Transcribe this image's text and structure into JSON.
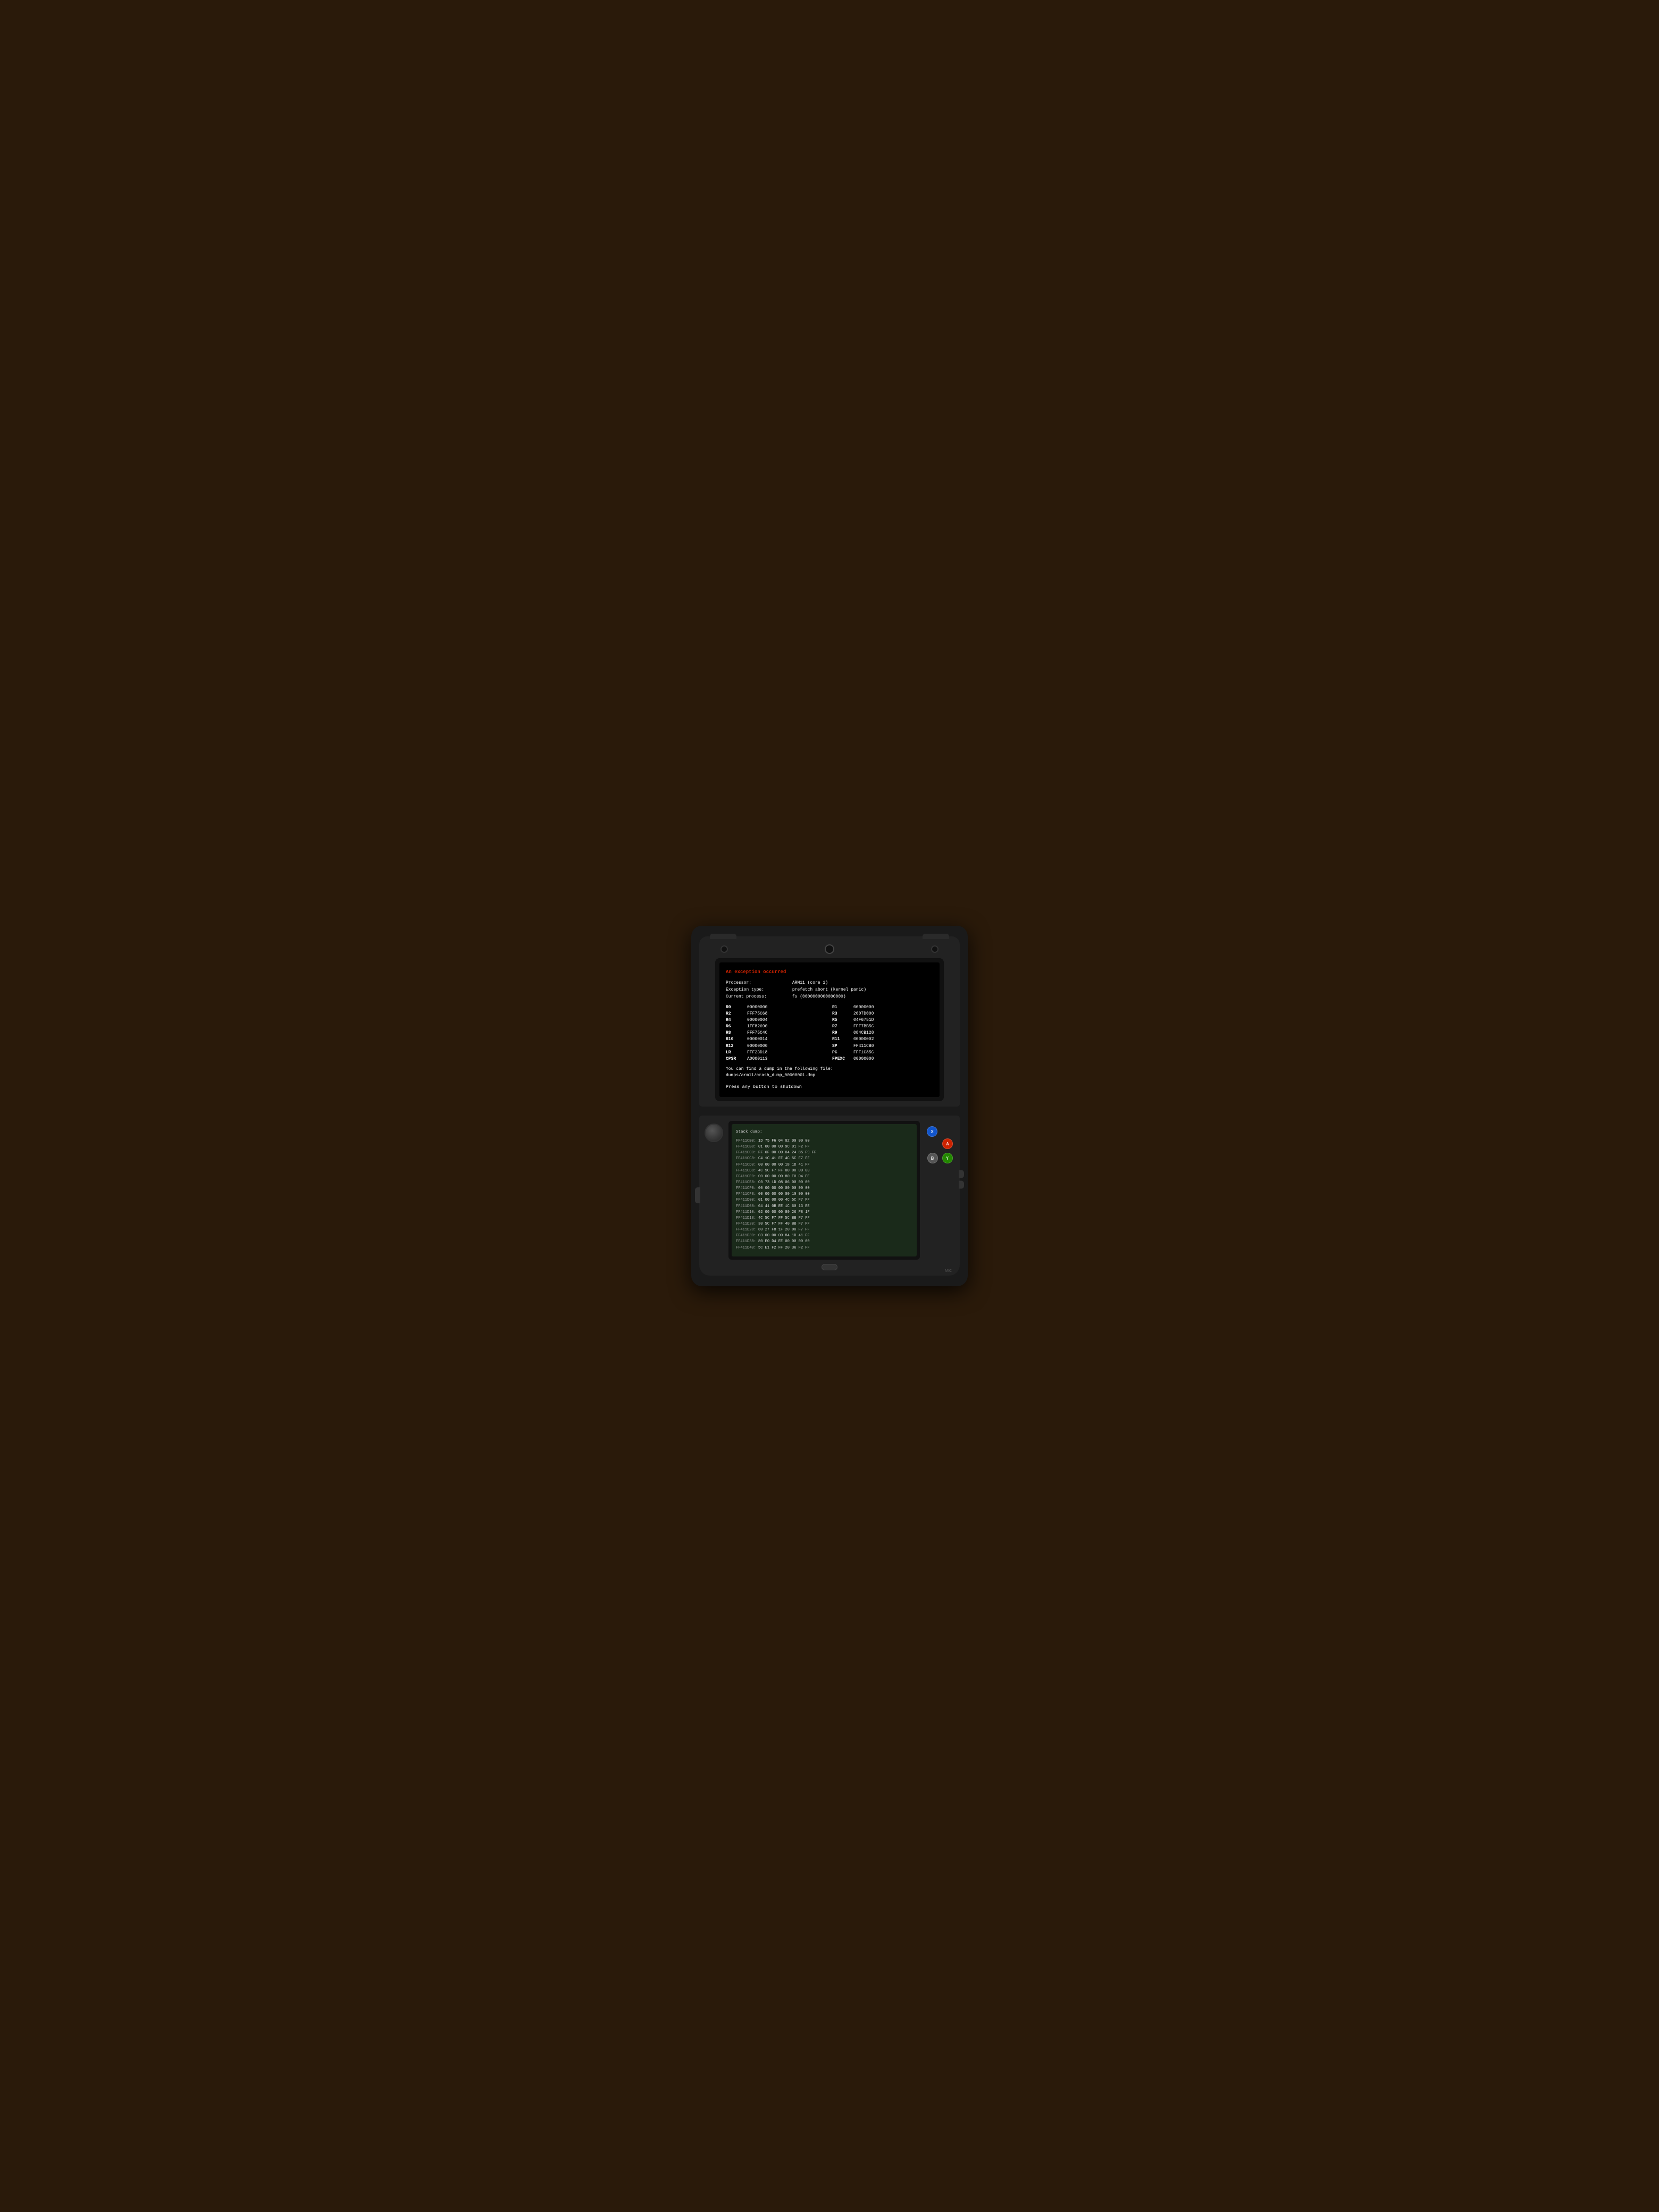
{
  "device": {
    "type": "Nintendo 3DS",
    "color": "black"
  },
  "top_screen": {
    "error_title": "An exception occurred",
    "processor_label": "Processor:",
    "processor_value": "ARM11 (core 1)",
    "exception_label": "Exception type:",
    "exception_value": "prefetch abort (kernel panic)",
    "process_label": "Current process:",
    "process_value": "fs (0000000000000000)",
    "registers": [
      {
        "name": "R0",
        "value": "00000000",
        "r_name": "R1",
        "r_value": "00000000"
      },
      {
        "name": "R2",
        "value": "FFF75C68",
        "r_name": "R3",
        "r_value": "2007D000"
      },
      {
        "name": "R4",
        "value": "00000004",
        "r_name": "R5",
        "r_value": "04F6751D"
      },
      {
        "name": "R6",
        "value": "1FF82690",
        "r_name": "R7",
        "r_value": "FFF7BB5C"
      },
      {
        "name": "R8",
        "value": "FFF75C4C",
        "r_name": "R9",
        "r_value": "084CB128"
      },
      {
        "name": "R10",
        "value": "00000014",
        "r_name": "R11",
        "r_value": "00000002"
      },
      {
        "name": "R12",
        "value": "00000000",
        "r_name": "SP",
        "r_value": "FF411CB0"
      },
      {
        "name": "LR",
        "value": "FFF23D18",
        "r_name": "PC",
        "r_value": "FFF1C85C"
      },
      {
        "name": "CPSR",
        "value": "A0000113",
        "r_name": "FPEXC",
        "r_value": "00000000"
      }
    ],
    "dump_message": "You can find a dump in the following file:",
    "dump_path": "dumps/arm11/crash_dump_00000001.dmp",
    "press_message": "Press any button to shutdown"
  },
  "bottom_screen": {
    "title": "Stack dump:",
    "rows": [
      {
        "addr": "FF411CB0:",
        "data": "1D 75 F6 04  02 00 00 00"
      },
      {
        "addr": "FF411CB8:",
        "data": "01 00 00 00  9C 01 F2 FF"
      },
      {
        "addr": "FF411CC0:",
        "data": "FF 6F 00 00  04 24 85 F9 FF"
      },
      {
        "addr": "FF411CC8:",
        "data": "C4 1C 41 FF  4C 5C F7 FF"
      },
      {
        "addr": "FF411CD0:",
        "data": "00 00 00 00  18 1D 41 FF"
      },
      {
        "addr": "FF411CD8:",
        "data": "4C 5C F7 FF  00 00 00 00"
      },
      {
        "addr": "FF411CE0:",
        "data": "00 00 00 00  80 E0 D4 EE"
      },
      {
        "addr": "FF411CE8:",
        "data": "C0 73 1D 08  06 00 00 00"
      },
      {
        "addr": "FF411CF0:",
        "data": "00 00 00 00  00 00 00 00"
      },
      {
        "addr": "FF411CF8:",
        "data": "00 00 00 00  00 10 00 00"
      },
      {
        "addr": "FF411D00:",
        "data": "01 00 00 00  4C 5C F7 FF"
      },
      {
        "addr": "FF411D08:",
        "data": "04 41 0B EE  1C 60 13 EE"
      },
      {
        "addr": "FF411D10:",
        "data": "02 00 00 00  80 26 F8 1F"
      },
      {
        "addr": "FF411D18:",
        "data": "4C 5C F7 FF  5C BB F7 FF"
      },
      {
        "addr": "FF411D20:",
        "data": "30 5C F7 FF  40 BB F7 FF"
      },
      {
        "addr": "FF411D28:",
        "data": "80 27 F8 1F  20 D0 F7 FF"
      },
      {
        "addr": "FF411D30:",
        "data": "03 00 00 00  84 1D 41 FF"
      },
      {
        "addr": "FF411D38:",
        "data": "80 E0 D4 EE  00 00 00 00"
      },
      {
        "addr": "FF411D40:",
        "data": "5C E1 F2 FF  20 36 F2 FF"
      }
    ]
  },
  "buttons": {
    "a": "A",
    "b": "B",
    "x": "X",
    "y": "Y"
  }
}
